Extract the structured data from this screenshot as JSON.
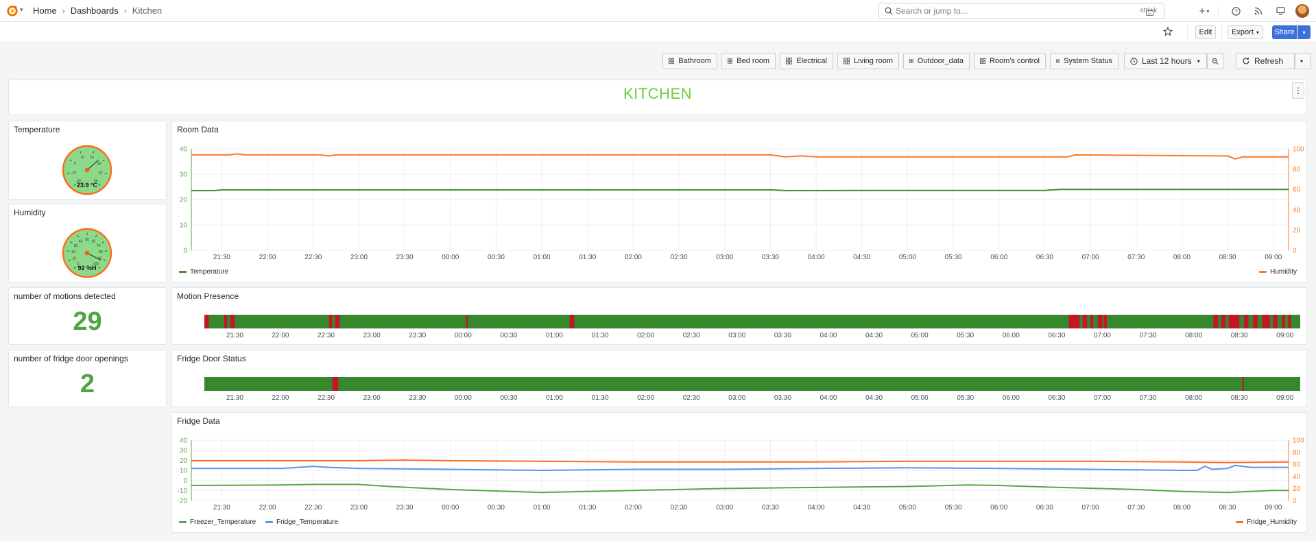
{
  "topbar": {
    "breadcrumbs": [
      "Home",
      "Dashboards",
      "Kitchen"
    ],
    "search_placeholder": "Search or jump to...",
    "search_shortcut": "ctrl+k"
  },
  "actions": {
    "edit": "Edit",
    "export": "Export",
    "share": "Share"
  },
  "dashboard_links": [
    "Bathroom",
    "Bed room",
    "Electrical",
    "Living room",
    "Outdoor_data",
    "Room's control",
    "System Status"
  ],
  "time_range": "Last 12 hours",
  "refresh_label": "Refresh",
  "banner": "KITCHEN",
  "gauges": {
    "temperature": {
      "title": "Temperature",
      "readout": "23.9 °C",
      "value": 23.9,
      "range": [
        -30,
        50
      ],
      "ticks": [
        "-30",
        "-10",
        "0",
        "10",
        "20",
        "30",
        "40",
        "50"
      ]
    },
    "humidity": {
      "title": "Humidity",
      "readout": "92 %H",
      "value": 92,
      "range": [
        0,
        100
      ],
      "ticks": [
        "0",
        "10",
        "20",
        "30",
        "40",
        "50",
        "60",
        "70",
        "80",
        "90",
        "100"
      ]
    }
  },
  "stats": {
    "motions": {
      "title": "number of motions detected",
      "value": "29"
    },
    "fridge_openings": {
      "title": "number of fridge door openings",
      "value": "2"
    }
  },
  "time_ticks": [
    "21:30",
    "22:00",
    "22:30",
    "23:00",
    "23:30",
    "00:00",
    "00:30",
    "01:00",
    "01:30",
    "02:00",
    "02:30",
    "03:00",
    "03:30",
    "04:00",
    "04:30",
    "05:00",
    "05:30",
    "06:00",
    "06:30",
    "07:00",
    "07:30",
    "08:00",
    "08:30",
    "09:00"
  ],
  "colors": {
    "green": "#37872d",
    "red": "#c4162a",
    "temperature": "#3f8f2f",
    "humidity": "#ff7722",
    "freezer": "#56a64b",
    "fridge": "#5794f2",
    "fridge_humidity": "#ff6f1f"
  },
  "chart_data": [
    {
      "type": "line",
      "title": "Room Data",
      "x_range": [
        "21:10",
        "09:10"
      ],
      "left_axis": {
        "ylim": [
          0,
          40
        ],
        "ticks": [
          "0",
          "10",
          "20",
          "30",
          "40"
        ]
      },
      "right_axis": {
        "ylim": [
          0,
          100
        ],
        "ticks": [
          "0",
          "20",
          "40",
          "60",
          "80",
          "100"
        ]
      },
      "series": [
        {
          "name": "Temperature",
          "axis": "left",
          "points": [
            [
              "21:10",
              23.5
            ],
            [
              "21:25",
              23.5
            ],
            [
              "21:30",
              23.8
            ],
            [
              "03:30",
              23.8
            ],
            [
              "03:40",
              23.5
            ],
            [
              "05:00",
              23.6
            ],
            [
              "06:30",
              23.6
            ],
            [
              "06:40",
              24.0
            ],
            [
              "09:10",
              24.0
            ]
          ]
        },
        {
          "name": "Humidity",
          "axis": "right",
          "points": [
            [
              "21:10",
              94
            ],
            [
              "21:35",
              94
            ],
            [
              "21:40",
              95
            ],
            [
              "21:45",
              94
            ],
            [
              "22:35",
              94
            ],
            [
              "22:40",
              93
            ],
            [
              "22:45",
              94
            ],
            [
              "03:30",
              94
            ],
            [
              "03:40",
              92
            ],
            [
              "03:50",
              93
            ],
            [
              "04:00",
              92
            ],
            [
              "06:45",
              92
            ],
            [
              "06:50",
              94
            ],
            [
              "08:30",
              93
            ],
            [
              "08:35",
              90
            ],
            [
              "08:40",
              92
            ],
            [
              "09:10",
              92
            ]
          ]
        }
      ]
    },
    {
      "type": "heatmap",
      "title": "Motion Presence",
      "x_range": [
        "21:10",
        "09:10"
      ],
      "states": [
        "no motion",
        "motion"
      ],
      "motion_intervals": [
        [
          "21:10",
          "21:13"
        ],
        [
          "21:23",
          "21:25"
        ],
        [
          "21:27",
          "21:30"
        ],
        [
          "22:32",
          "22:34"
        ],
        [
          "22:36",
          "22:39"
        ],
        [
          "00:02",
          "00:03"
        ],
        [
          "01:10",
          "01:13"
        ],
        [
          "06:38",
          "06:45"
        ],
        [
          "06:47",
          "06:50"
        ],
        [
          "06:52",
          "06:54"
        ],
        [
          "06:57",
          "07:00"
        ],
        [
          "07:01",
          "07:03"
        ],
        [
          "08:13",
          "08:16"
        ],
        [
          "08:18",
          "08:21"
        ],
        [
          "08:23",
          "08:30"
        ],
        [
          "08:33",
          "08:36"
        ],
        [
          "08:39",
          "08:42"
        ],
        [
          "08:45",
          "08:50"
        ],
        [
          "08:52",
          "08:55"
        ],
        [
          "08:58",
          "09:00"
        ],
        [
          "09:02",
          "09:04"
        ]
      ]
    },
    {
      "type": "heatmap",
      "title": "Fridge Door Status",
      "x_range": [
        "21:10",
        "09:10"
      ],
      "states": [
        "closed",
        "open"
      ],
      "open_intervals": [
        [
          "22:34",
          "22:38"
        ],
        [
          "08:32",
          "08:33"
        ]
      ]
    },
    {
      "type": "line",
      "title": "Fridge Data",
      "x_range": [
        "21:10",
        "09:10"
      ],
      "left_axis": {
        "ylim": [
          -20,
          40
        ],
        "ticks": [
          "-20",
          "-10",
          "0",
          "10",
          "20",
          "30",
          "40"
        ]
      },
      "right_axis": {
        "ylim": [
          0,
          100
        ],
        "ticks": [
          "0",
          "20",
          "40",
          "60",
          "80",
          "100"
        ]
      },
      "series": [
        {
          "name": "Freezer_Temperature",
          "axis": "left",
          "points": [
            [
              "21:10",
              -5
            ],
            [
              "22:10",
              -4.5
            ],
            [
              "22:30",
              -4
            ],
            [
              "23:00",
              -4
            ],
            [
              "23:20",
              -6
            ],
            [
              "00:00",
              -9
            ],
            [
              "01:00",
              -12
            ],
            [
              "02:00",
              -10
            ],
            [
              "03:00",
              -8
            ],
            [
              "04:00",
              -7
            ],
            [
              "05:00",
              -6
            ],
            [
              "05:40",
              -4.5
            ],
            [
              "06:00",
              -5
            ],
            [
              "06:40",
              -7
            ],
            [
              "07:30",
              -9
            ],
            [
              "08:00",
              -11
            ],
            [
              "08:30",
              -12
            ],
            [
              "09:00",
              -10
            ],
            [
              "09:10",
              -10
            ]
          ]
        },
        {
          "name": "Fridge_Temperature",
          "axis": "left",
          "points": [
            [
              "21:10",
              12
            ],
            [
              "22:10",
              12
            ],
            [
              "22:20",
              13
            ],
            [
              "22:30",
              14
            ],
            [
              "22:40",
              13
            ],
            [
              "23:00",
              12
            ],
            [
              "00:00",
              11
            ],
            [
              "01:00",
              10
            ],
            [
              "02:00",
              11
            ],
            [
              "03:00",
              11
            ],
            [
              "04:00",
              12
            ],
            [
              "05:00",
              12.5
            ],
            [
              "06:00",
              12
            ],
            [
              "07:00",
              11
            ],
            [
              "08:00",
              10
            ],
            [
              "08:10",
              10
            ],
            [
              "08:15",
              14
            ],
            [
              "08:20",
              11
            ],
            [
              "08:30",
              12
            ],
            [
              "08:35",
              15
            ],
            [
              "08:45",
              13
            ],
            [
              "09:10",
              13
            ]
          ]
        },
        {
          "name": "Fridge_Humidity",
          "axis": "right",
          "points": [
            [
              "21:10",
              66
            ],
            [
              "23:00",
              66
            ],
            [
              "23:30",
              67
            ],
            [
              "00:00",
              66
            ],
            [
              "01:00",
              65
            ],
            [
              "02:00",
              64
            ],
            [
              "03:00",
              64
            ],
            [
              "04:00",
              64
            ],
            [
              "05:00",
              65
            ],
            [
              "06:00",
              65
            ],
            [
              "07:00",
              65
            ],
            [
              "08:00",
              64
            ],
            [
              "08:30",
              63
            ],
            [
              "09:10",
              64
            ]
          ]
        }
      ]
    }
  ]
}
